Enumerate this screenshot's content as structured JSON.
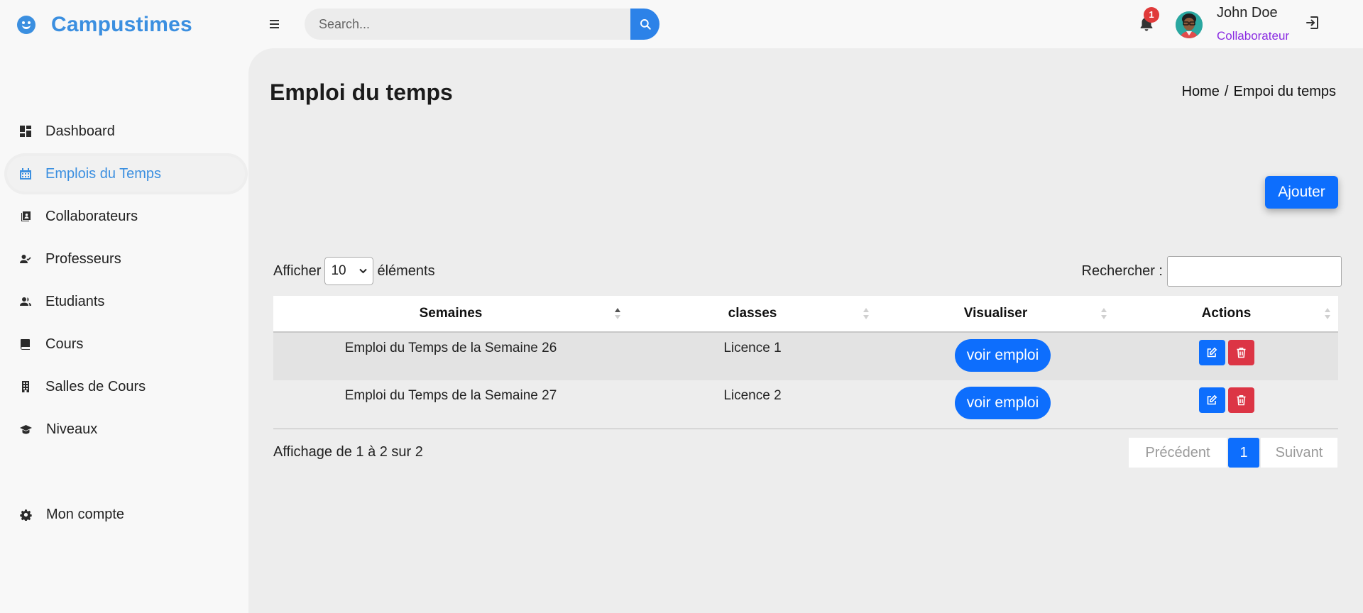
{
  "app": {
    "name": "Campustimes"
  },
  "search": {
    "placeholder": "Search..."
  },
  "notifications": {
    "count": "1"
  },
  "user": {
    "name": "John Doe",
    "role": "Collaborateur"
  },
  "sidebar": {
    "items": [
      {
        "label": "Dashboard",
        "icon": "dashboard-icon"
      },
      {
        "label": "Emplois du Temps",
        "icon": "calendar-icon",
        "active": true
      },
      {
        "label": "Collaborateurs",
        "icon": "contacts-icon"
      },
      {
        "label": "Professeurs",
        "icon": "user-check-icon"
      },
      {
        "label": "Etudiants",
        "icon": "users-icon"
      },
      {
        "label": "Cours",
        "icon": "book-icon"
      },
      {
        "label": "Salles de Cours",
        "icon": "building-icon"
      },
      {
        "label": "Niveaux",
        "icon": "graduation-cap-icon"
      },
      {
        "label": "Mon compte",
        "icon": "gear-icon"
      }
    ]
  },
  "page": {
    "title": "Emploi du temps",
    "breadcrumb": {
      "home": "Home",
      "separator": "/",
      "current": "Empoi du temps"
    },
    "add_label": "Ajouter"
  },
  "table_controls": {
    "length_prefix": "Afficher",
    "length_value": "10",
    "length_suffix": "éléments",
    "search_label": "Rechercher :",
    "search_value": ""
  },
  "table": {
    "columns": [
      "Semaines",
      "classes",
      "Visualiser",
      "Actions"
    ],
    "rows": [
      {
        "semaine": "Emploi du Temps de la Semaine 26",
        "classe": "Licence 1",
        "view_label": "voir emploi"
      },
      {
        "semaine": "Emploi du Temps de la Semaine 27",
        "classe": "Licence 2",
        "view_label": "voir emploi"
      }
    ]
  },
  "footer": {
    "info": "Affichage de 1 à 2 sur 2",
    "prev": "Précédent",
    "page": "1",
    "next": "Suivant"
  },
  "colors": {
    "brand": "#3b8fe0",
    "primary": "#0d6efd",
    "danger": "#dc3545",
    "role": "#8a2be2"
  }
}
